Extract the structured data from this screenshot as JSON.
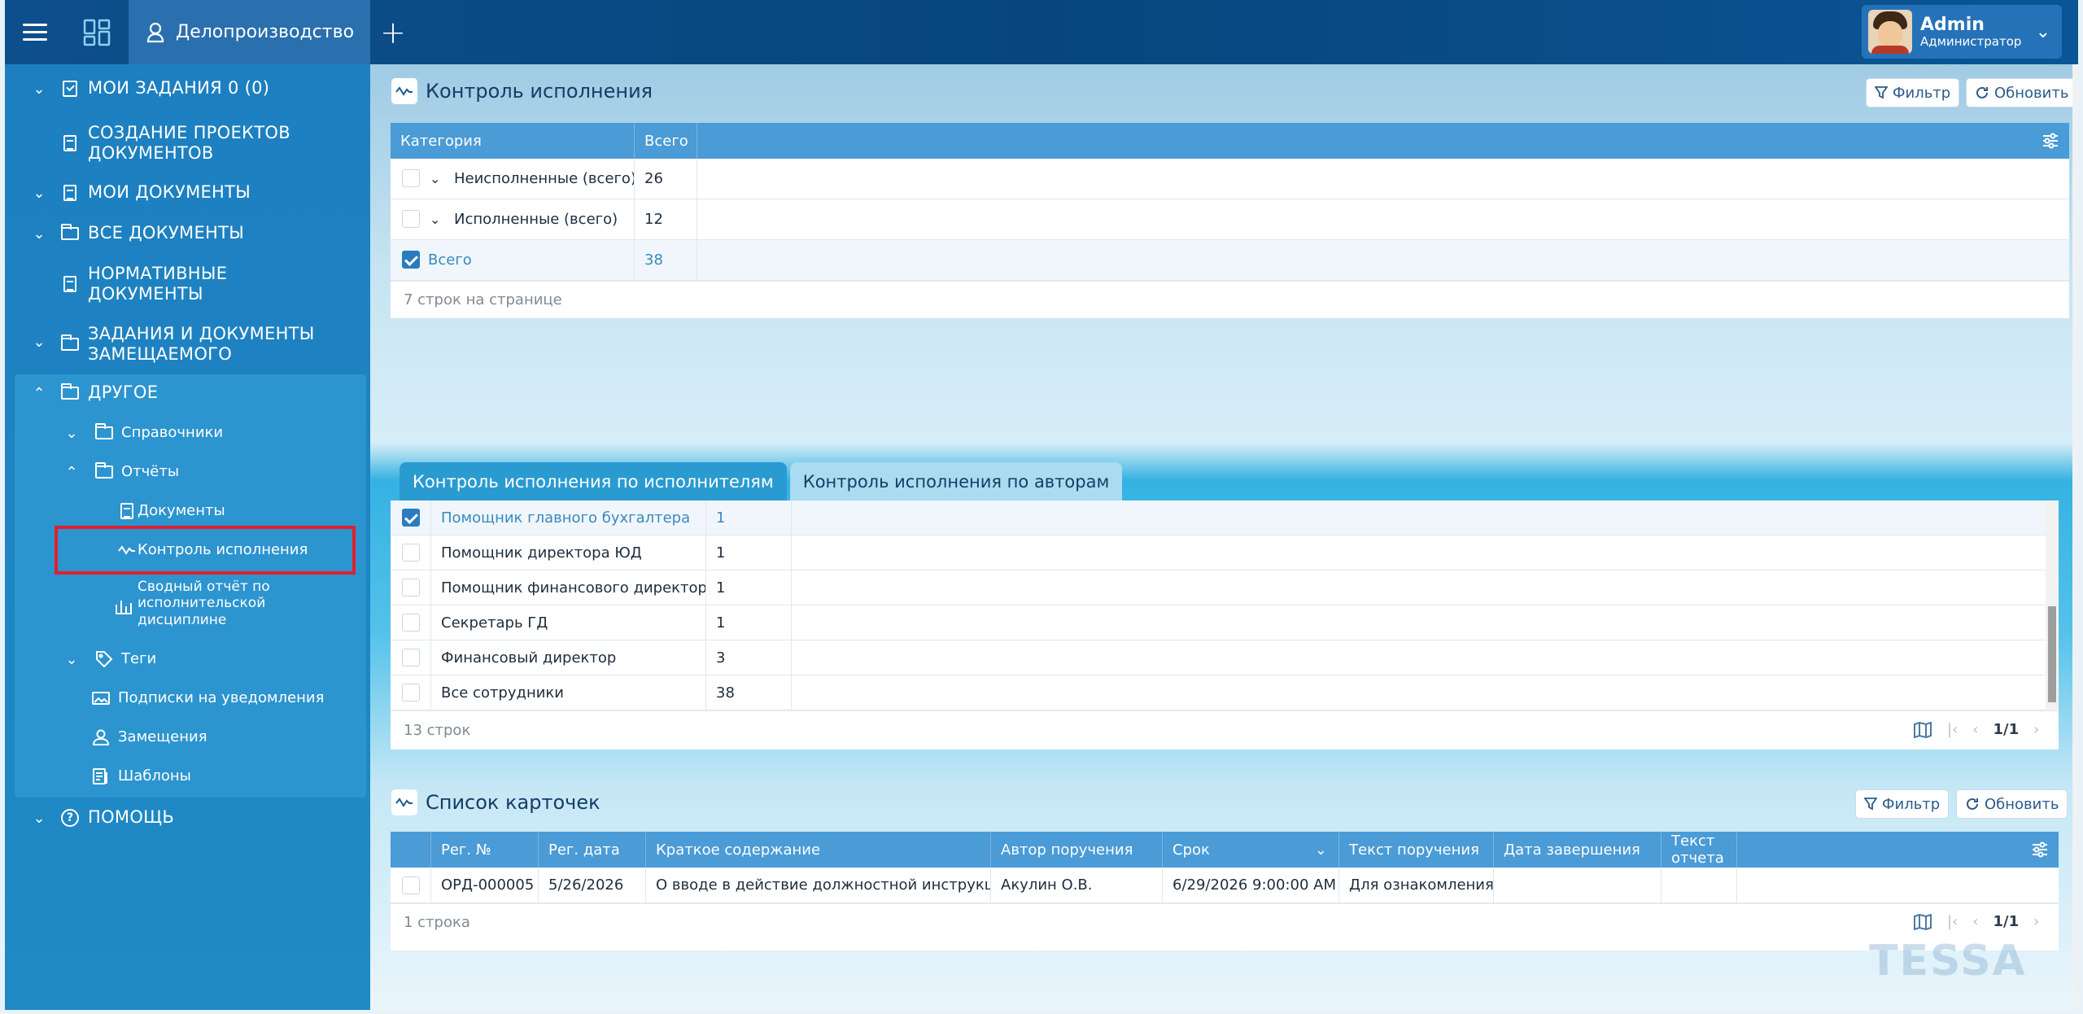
{
  "topbar": {
    "app_title": "Делопроизводство",
    "user_name": "Admin",
    "user_role": "Администратор"
  },
  "sidebar": {
    "items": [
      {
        "label": "МОИ ЗАДАНИЯ 0 (0)"
      },
      {
        "label": "СОЗДАНИЕ ПРОЕКТОВ ДОКУМЕНТОВ"
      },
      {
        "label": "МОИ ДОКУМЕНТЫ"
      },
      {
        "label": "ВСЕ ДОКУМЕНТЫ"
      },
      {
        "label": "НОРМАТИВНЫЕ ДОКУМЕНТЫ"
      },
      {
        "label": "ЗАДАНИЯ И ДОКУМЕНТЫ ЗАМЕЩАЕМОГО"
      },
      {
        "label": "ДРУГОЕ"
      },
      {
        "label": "Справочники"
      },
      {
        "label": "Отчёты"
      },
      {
        "label": "Документы"
      },
      {
        "label": "Контроль исполнения"
      },
      {
        "label": "Сводный отчёт по исполнительской дисциплине"
      },
      {
        "label": "Теги"
      },
      {
        "label": "Подписки на уведомления"
      },
      {
        "label": "Замещения"
      },
      {
        "label": "Шаблоны"
      },
      {
        "label": "ПОМОЩЬ"
      }
    ]
  },
  "control": {
    "title": "Контроль исполнения",
    "filter_label": "Фильтр",
    "refresh_label": "Обновить",
    "columns": [
      "Категория",
      "Всего"
    ],
    "rows": [
      {
        "label": "Неисполненные (всего)",
        "value": "26"
      },
      {
        "label": "Исполненные (всего)",
        "value": "12"
      },
      {
        "label": "Всего",
        "value": "38"
      }
    ],
    "footer": "7 строк на странице"
  },
  "tabs": [
    "Контроль исполнения по исполнителям",
    "Контроль исполнения по авторам"
  ],
  "authors": {
    "rows": [
      {
        "label": "Помощник главного бухгалтера",
        "value": "1"
      },
      {
        "label": "Помощник директора ЮД",
        "value": "1"
      },
      {
        "label": "Помощник финансового директора",
        "value": "1"
      },
      {
        "label": "Секретарь ГД",
        "value": "1"
      },
      {
        "label": "Финансовый директор",
        "value": "3"
      },
      {
        "label": "Все сотрудники",
        "value": "38"
      }
    ],
    "footer": "13 строк",
    "page": "1/1"
  },
  "cards": {
    "title": "Список карточек",
    "filter_label": "Фильтр",
    "refresh_label": "Обновить",
    "columns": [
      "Рег. №",
      "Рег. дата",
      "Краткое содержание",
      "Автор поручения",
      "Срок",
      "Текст поручения",
      "Дата завершения",
      "Текст отчета"
    ],
    "rows": [
      [
        "ОРД-000005",
        "5/26/2026",
        "О вводе в действие должностной инструкции",
        "Акулин О.В.",
        "6/29/2026 9:00:00 AM",
        "Для ознакомления",
        "",
        ""
      ]
    ],
    "footer": "1 строка",
    "page": "1/1"
  },
  "watermark": "TESSA"
}
